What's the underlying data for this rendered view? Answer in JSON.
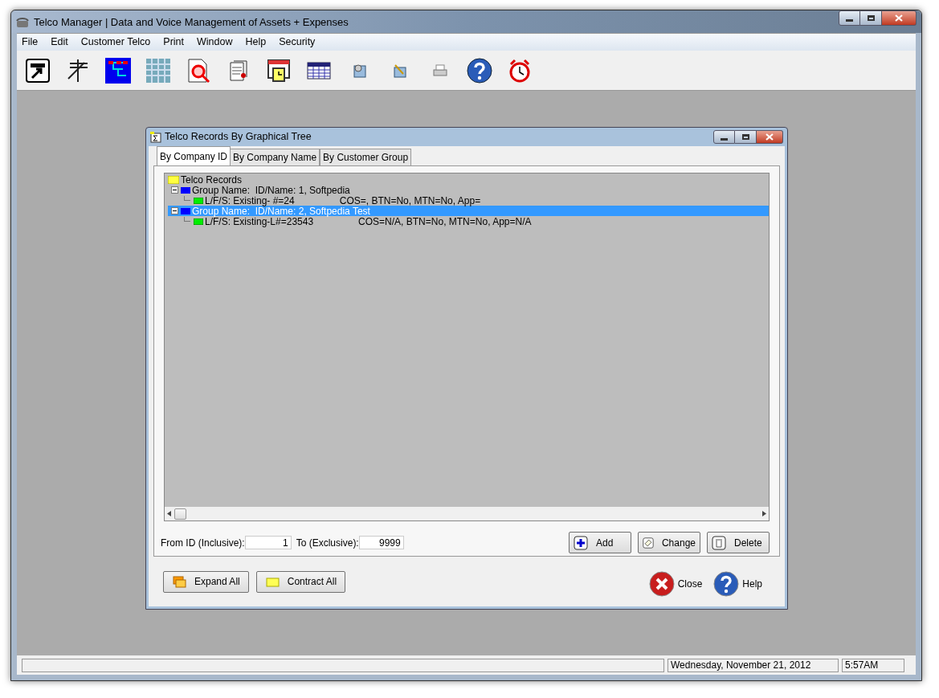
{
  "window": {
    "title": "Telco Manager | Data and Voice Management of Assets + Expenses"
  },
  "menu": [
    "File",
    "Edit",
    "Customer Telco",
    "Print",
    "Window",
    "Help",
    "Security"
  ],
  "dialog": {
    "title": "Telco Records By Graphical Tree",
    "tabs": [
      {
        "label": "By Company ID",
        "selected": true
      },
      {
        "label": "By Company Name",
        "selected": false
      },
      {
        "label": "By Customer Group",
        "selected": false
      }
    ],
    "tree": [
      {
        "kind": "root",
        "label": "Telco Records",
        "selected": false,
        "children": [
          {
            "kind": "group",
            "label": "Group Name:  ID/Name: 1, Softpedia",
            "selected": false,
            "expanded": true,
            "children": [
              {
                "kind": "line",
                "label": "L/F/S: Existing- #=24",
                "detail": "COS=, BTN=No, MTN=No, App=",
                "selected": false
              }
            ]
          },
          {
            "kind": "group",
            "label": "Group Name:  ID/Name: 2, Softpedia Test",
            "selected": true,
            "expanded": true,
            "children": [
              {
                "kind": "line",
                "label": "L/F/S: Existing-L#=23543",
                "detail": "COS=N/A, BTN=No, MTN=No, App=N/A",
                "selected": false
              }
            ]
          }
        ]
      }
    ],
    "from_field": {
      "label": "From ID (Inclusive):",
      "value": "1"
    },
    "to_field": {
      "label": "To (Exclusive):",
      "value": "9999"
    },
    "record_buttons": [
      {
        "kind": "add",
        "label": "Add"
      },
      {
        "kind": "change",
        "label": "Change"
      },
      {
        "kind": "delete",
        "label": "Delete"
      }
    ],
    "tree_buttons": [
      {
        "kind": "expand",
        "label": "Expand All"
      },
      {
        "kind": "contract",
        "label": "Contract All"
      }
    ],
    "action_buttons": [
      {
        "kind": "close",
        "label": "Close"
      },
      {
        "kind": "help",
        "label": "Help"
      }
    ]
  },
  "status_bar": {
    "date": "Wednesday, November 21, 2012",
    "time": "5:57AM"
  }
}
